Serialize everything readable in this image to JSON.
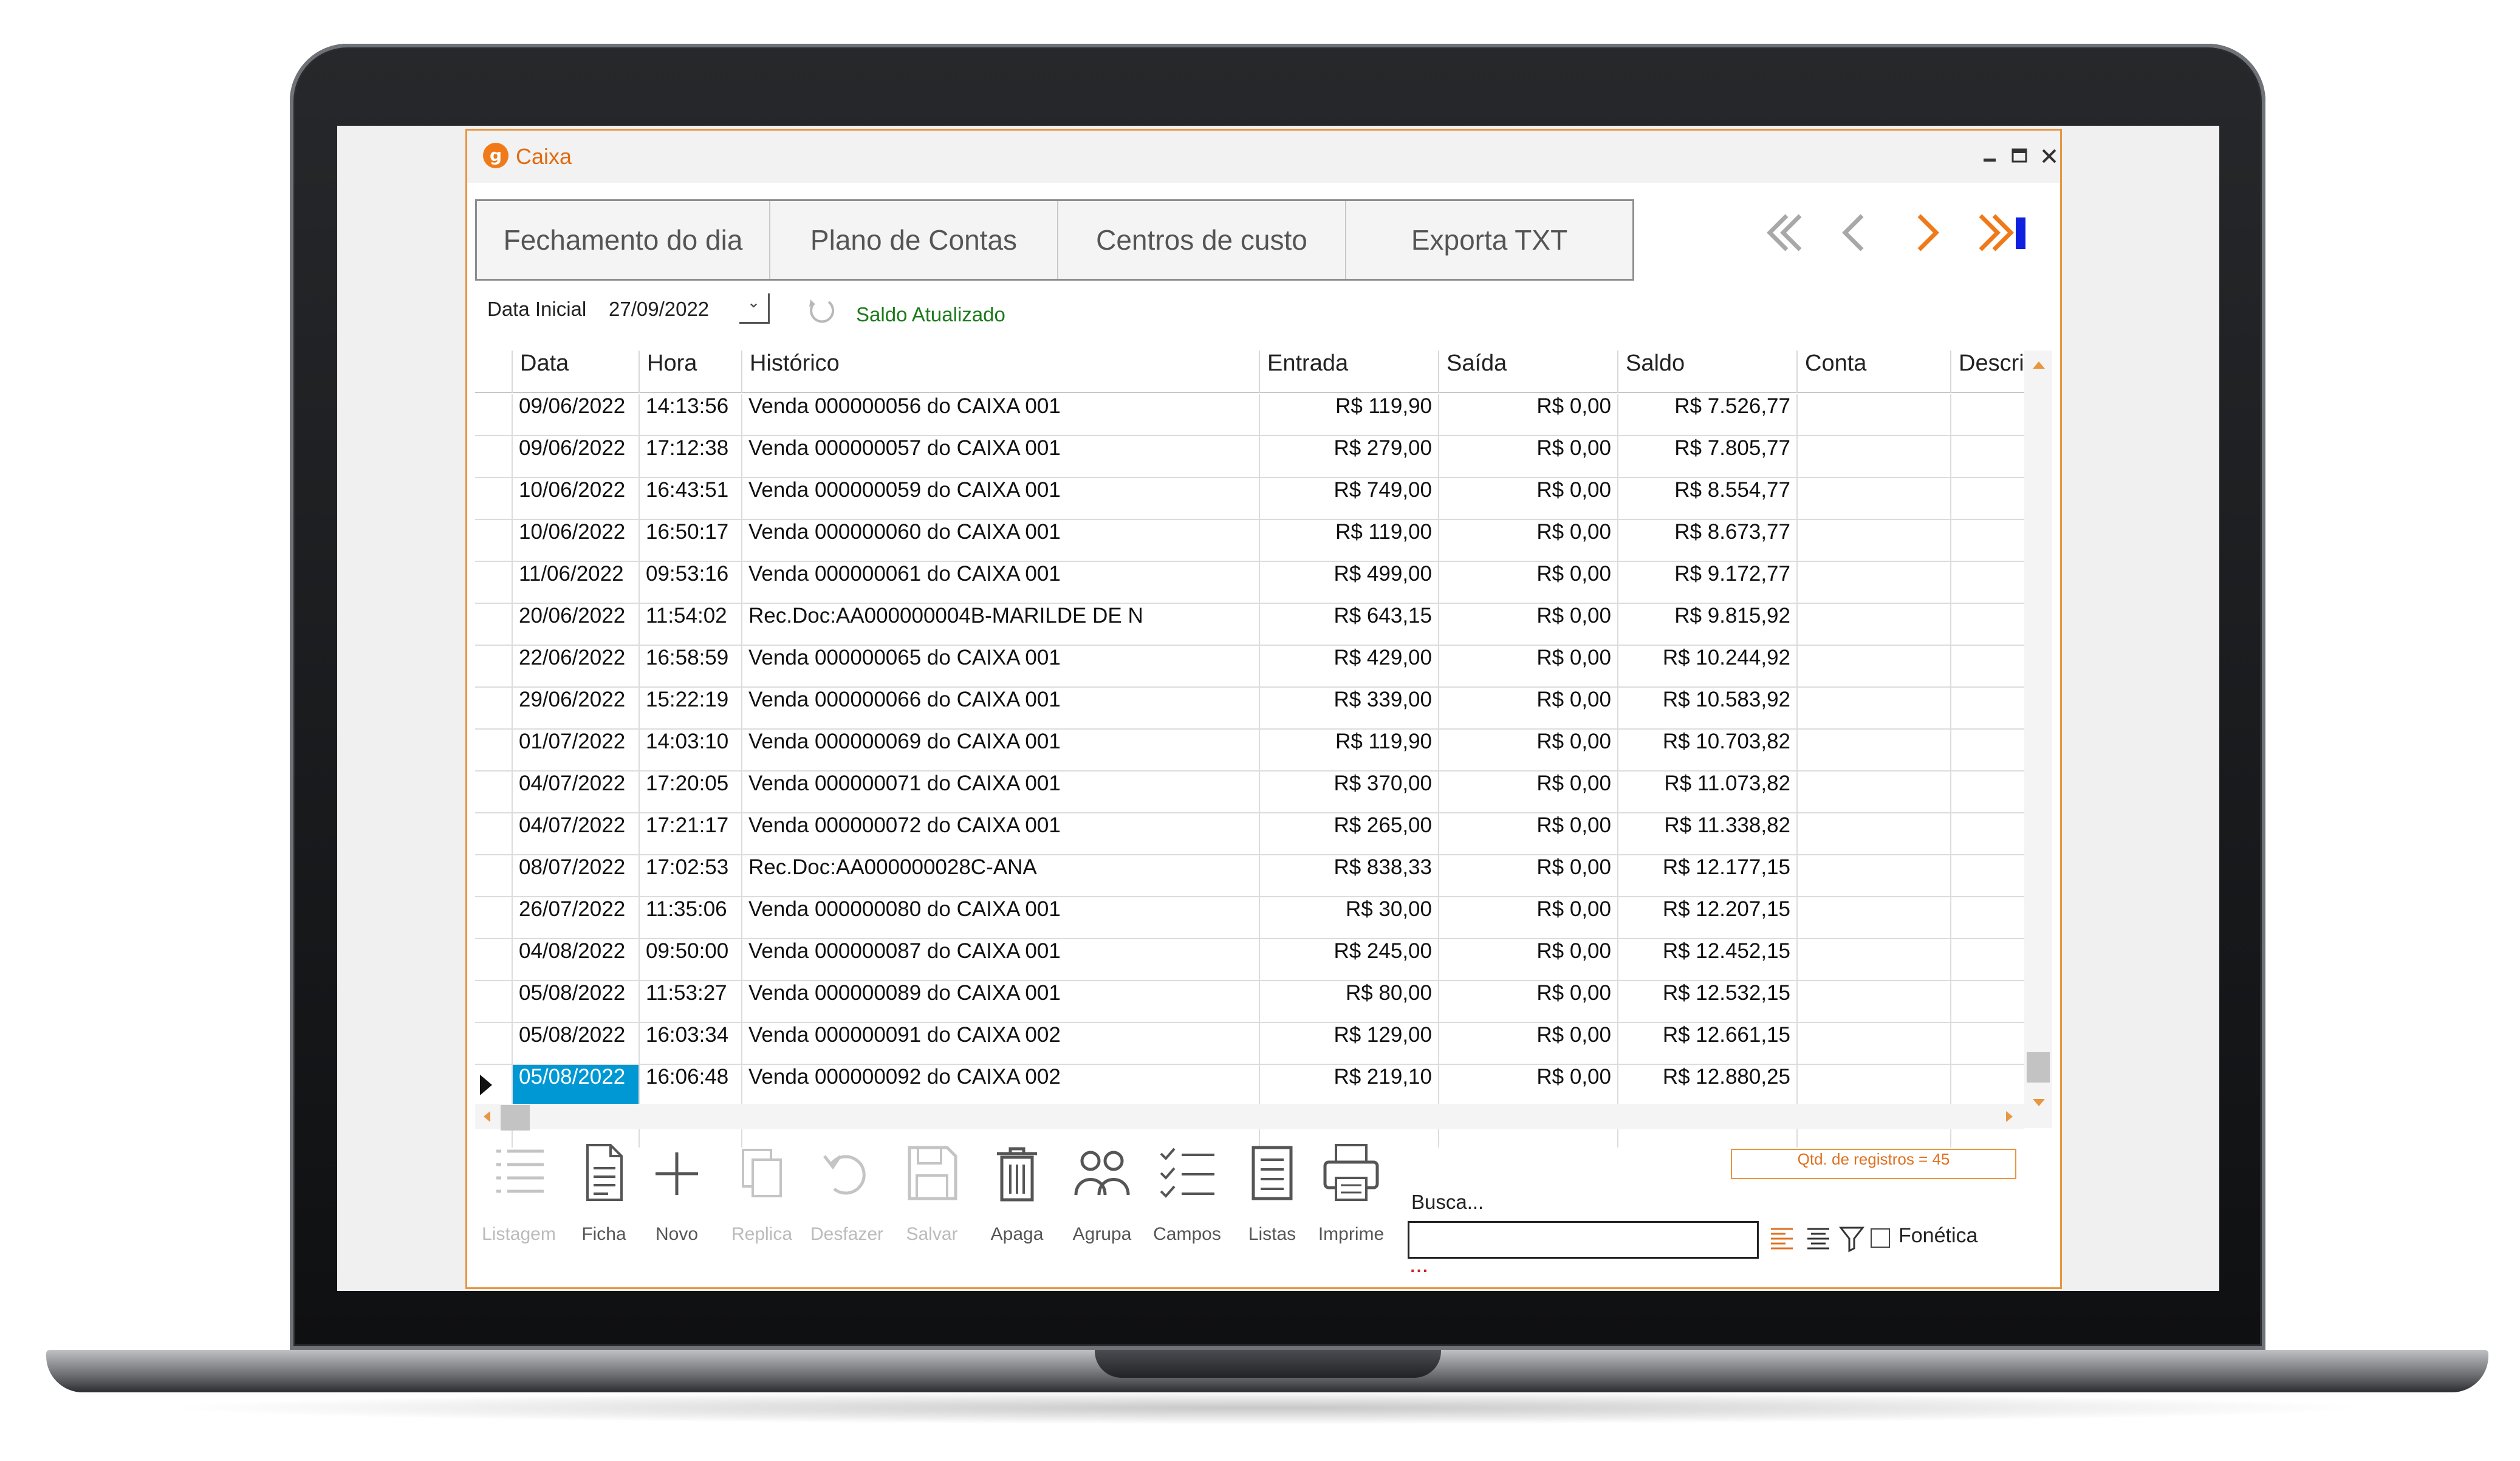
{
  "window": {
    "title": "Caixa",
    "logo_glyph": "g"
  },
  "tabs": [
    "Fechamento do dia",
    "Plano de Contas",
    "Centros de custo",
    "Exporta TXT"
  ],
  "filter": {
    "label": "Data Inicial",
    "value": "27/09/2022",
    "status": "Saldo Atualizado"
  },
  "columns": [
    "Data",
    "Hora",
    "Histórico",
    "Entrada",
    "Saída",
    "Saldo",
    "Conta",
    "Descri"
  ],
  "rows": [
    [
      "09/06/2022",
      "14:13:56",
      "Venda 000000056 do CAIXA 001",
      "R$ 119,90",
      "R$ 0,00",
      "R$ 7.526,77"
    ],
    [
      "09/06/2022",
      "17:12:38",
      "Venda 000000057 do CAIXA 001",
      "R$ 279,00",
      "R$ 0,00",
      "R$ 7.805,77"
    ],
    [
      "10/06/2022",
      "16:43:51",
      "Venda 000000059 do CAIXA 001",
      "R$ 749,00",
      "R$ 0,00",
      "R$ 8.554,77"
    ],
    [
      "10/06/2022",
      "16:50:17",
      "Venda 000000060 do CAIXA 001",
      "R$ 119,00",
      "R$ 0,00",
      "R$ 8.673,77"
    ],
    [
      "11/06/2022",
      "09:53:16",
      "Venda 000000061 do CAIXA 001",
      "R$ 499,00",
      "R$ 0,00",
      "R$ 9.172,77"
    ],
    [
      "20/06/2022",
      "11:54:02",
      "Rec.Doc:AA000000004B-MARILDE DE N",
      "R$ 643,15",
      "R$ 0,00",
      "R$ 9.815,92"
    ],
    [
      "22/06/2022",
      "16:58:59",
      "Venda 000000065 do CAIXA 001",
      "R$ 429,00",
      "R$ 0,00",
      "R$ 10.244,92"
    ],
    [
      "29/06/2022",
      "15:22:19",
      "Venda 000000066 do CAIXA 001",
      "R$ 339,00",
      "R$ 0,00",
      "R$ 10.583,92"
    ],
    [
      "01/07/2022",
      "14:03:10",
      "Venda 000000069 do CAIXA 001",
      "R$ 119,90",
      "R$ 0,00",
      "R$ 10.703,82"
    ],
    [
      "04/07/2022",
      "17:20:05",
      "Venda 000000071 do CAIXA 001",
      "R$ 370,00",
      "R$ 0,00",
      "R$ 11.073,82"
    ],
    [
      "04/07/2022",
      "17:21:17",
      "Venda 000000072 do CAIXA 001",
      "R$ 265,00",
      "R$ 0,00",
      "R$ 11.338,82"
    ],
    [
      "08/07/2022",
      "17:02:53",
      "Rec.Doc:AA000000028C-ANA",
      "R$ 838,33",
      "R$ 0,00",
      "R$ 12.177,15"
    ],
    [
      "26/07/2022",
      "11:35:06",
      "Venda 000000080 do CAIXA 001",
      "R$ 30,00",
      "R$ 0,00",
      "R$ 12.207,15"
    ],
    [
      "04/08/2022",
      "09:50:00",
      "Venda 000000087 do CAIXA 001",
      "R$ 245,00",
      "R$ 0,00",
      "R$ 12.452,15"
    ],
    [
      "05/08/2022",
      "11:53:27",
      "Venda 000000089 do CAIXA 001",
      "R$ 80,00",
      "R$ 0,00",
      "R$ 12.532,15"
    ],
    [
      "05/08/2022",
      "16:03:34",
      "Venda 000000091 do CAIXA 002",
      "R$ 129,00",
      "R$ 0,00",
      "R$ 12.661,15"
    ],
    [
      "05/08/2022",
      "16:06:48",
      "Venda 000000092 do CAIXA 002",
      "R$ 219,10",
      "R$ 0,00",
      "R$ 12.880,25"
    ]
  ],
  "selected_row": 16,
  "toolbar": [
    {
      "label": "Listagem",
      "icon": "list-icon",
      "enabled": false
    },
    {
      "label": "Ficha",
      "icon": "document-icon",
      "enabled": true
    },
    {
      "label": "Novo",
      "icon": "plus-icon",
      "enabled": true
    },
    {
      "label": "Replica",
      "icon": "copy-icon",
      "enabled": false
    },
    {
      "label": "Desfazer",
      "icon": "undo-icon",
      "enabled": false
    },
    {
      "label": "Salvar",
      "icon": "save-icon",
      "enabled": false
    },
    {
      "label": "Apaga",
      "icon": "trash-icon",
      "enabled": true
    },
    {
      "label": "Agrupa",
      "icon": "group-icon",
      "enabled": true
    },
    {
      "label": "Campos",
      "icon": "checklist-icon",
      "enabled": true
    },
    {
      "label": "Listas",
      "icon": "list-box-icon",
      "enabled": true
    },
    {
      "label": "Imprime",
      "icon": "printer-icon",
      "enabled": true
    }
  ],
  "records_count": "Qtd. de registros = 45",
  "search": {
    "label": "Busca...",
    "value": "",
    "dots": "...",
    "phonetic_label": "Fonética",
    "phonetic_checked": false
  },
  "colors": {
    "accent": "#e8963f",
    "selection": "#0098d4",
    "status_green": "#1a7a1a",
    "nav_orange": "#f07a1a",
    "nav_blue": "#1020e0"
  }
}
